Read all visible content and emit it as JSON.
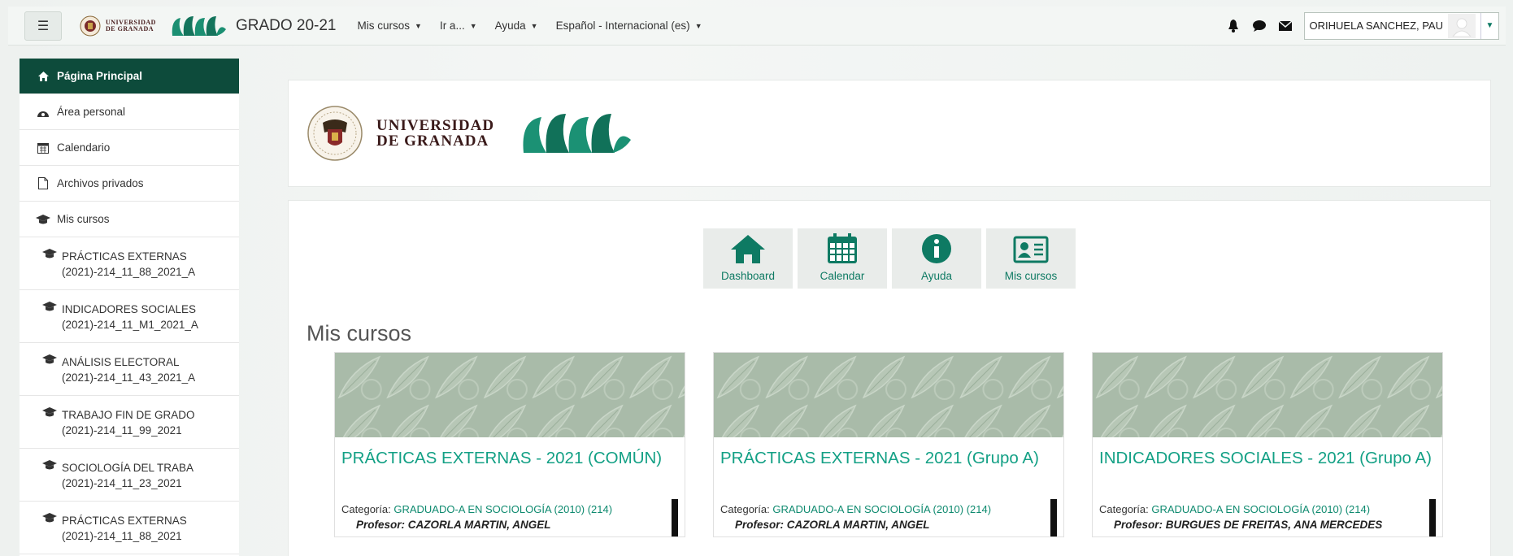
{
  "navbar": {
    "ugr_small": [
      "UNIVERSIDAD",
      "DE GRANADA"
    ],
    "site_name": "GRADO 20-21",
    "menu": [
      {
        "label": "Mis cursos"
      },
      {
        "label": "Ir a..."
      },
      {
        "label": "Ayuda"
      },
      {
        "label": "Español - Internacional (es)"
      }
    ],
    "user_name": "ORIHUELA SANCHEZ, PAU"
  },
  "sidebar": {
    "items": [
      {
        "label": "Página Principal",
        "icon": "home-icon"
      },
      {
        "label": "Área personal",
        "icon": "dashboard-icon"
      },
      {
        "label": "Calendario",
        "icon": "calendar-icon"
      },
      {
        "label": "Archivos privados",
        "icon": "file-icon"
      },
      {
        "label": "Mis cursos",
        "icon": "graduation-cap-icon"
      }
    ],
    "courses": [
      {
        "line1": "PRÁCTICAS EXTERNAS",
        "line2": "(2021)-214_11_88_2021_A"
      },
      {
        "line1": "INDICADORES SOCIALES",
        "line2": "(2021)-214_11_M1_2021_A"
      },
      {
        "line1": "ANÁLISIS ELECTORAL",
        "line2": "(2021)-214_11_43_2021_A"
      },
      {
        "line1": "TRABAJO FIN DE GRADO",
        "line2": "(2021)-214_11_99_2021"
      },
      {
        "line1": "SOCIOLOGÍA DEL TRABA",
        "line2": "(2021)-214_11_23_2021"
      },
      {
        "line1": "PRÁCTICAS EXTERNAS",
        "line2": "(2021)-214_11_88_2021"
      }
    ]
  },
  "header": {
    "ugr_lines": [
      "UNIVERSIDAD",
      "DE GRANADA"
    ]
  },
  "quick_links": [
    {
      "label": "Dashboard",
      "icon": "home-icon"
    },
    {
      "label": "Calendar",
      "icon": "calendar-icon"
    },
    {
      "label": "Ayuda",
      "icon": "info-icon"
    },
    {
      "label": "Mis cursos",
      "icon": "id-card-icon"
    }
  ],
  "main": {
    "section_title": "Mis cursos",
    "courses": [
      {
        "title": "PRÁCTICAS EXTERNAS - 2021 (COMÚN)",
        "category_label": "Categoría:",
        "category": "GRADUADO-A EN SOCIOLOGÍA (2010) (214)",
        "professor_label": "Profesor:",
        "professor": "CAZORLA MARTIN, ANGEL"
      },
      {
        "title": "PRÁCTICAS EXTERNAS - 2021 (Grupo A)",
        "category_label": "Categoría:",
        "category": "GRADUADO-A EN SOCIOLOGÍA (2010) (214)",
        "professor_label": "Profesor:",
        "professor": "CAZORLA MARTIN, ANGEL"
      },
      {
        "title": "INDICADORES SOCIALES - 2021 (Grupo A)",
        "category_label": "Categoría:",
        "category": "GRADUADO-A EN SOCIOLOGÍA (2010) (214)",
        "professor_label": "Profesor:",
        "professor": "BURGUES DE FREITAS, ANA MERCEDES"
      }
    ]
  },
  "colors": {
    "primary_dark": "#0d4b3b",
    "accent": "#13a085",
    "link": "#0e8a6f"
  }
}
